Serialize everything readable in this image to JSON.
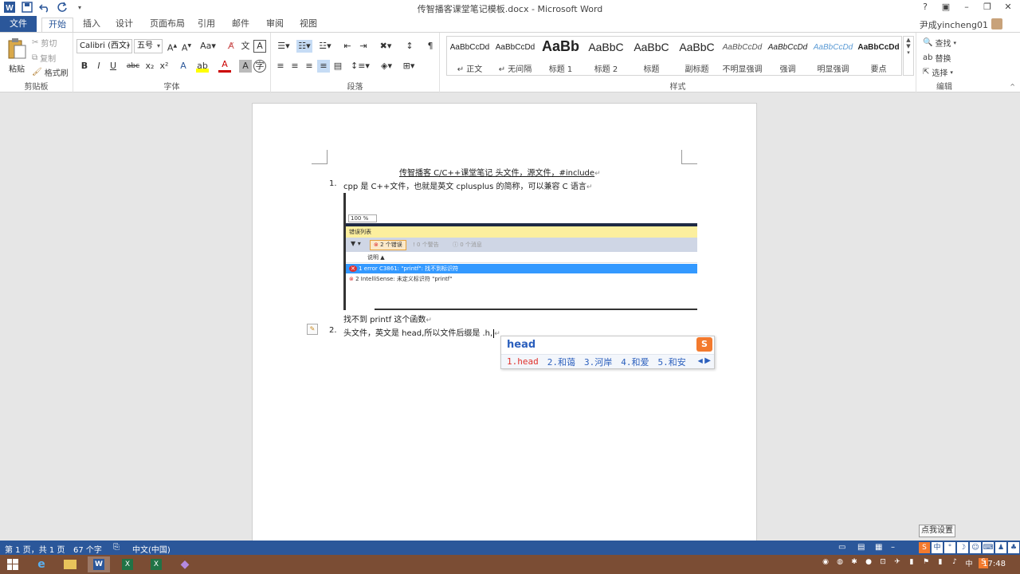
{
  "window": {
    "title": "传智播客课堂笔记模板.docx - Microsoft Word",
    "user": "尹成yincheng01",
    "controls": [
      "?",
      "▣",
      "–",
      "❐",
      "✕"
    ]
  },
  "tabs": {
    "file": "文件",
    "items": [
      "开始",
      "插入",
      "设计",
      "页面布局",
      "引用",
      "邮件",
      "审阅",
      "视图"
    ],
    "active": "开始"
  },
  "ribbon": {
    "clipboard": {
      "label": "剪贴板",
      "paste": "粘贴",
      "cut": "剪切",
      "copy": "复制",
      "format_painter": "格式刷"
    },
    "font": {
      "label": "字体",
      "font_name": "Calibri (西文)",
      "font_size": "五号"
    },
    "paragraph": {
      "label": "段落"
    },
    "styles": {
      "label": "样式",
      "items": [
        {
          "sample": "AaBbCcDd",
          "name": "↵ 正文"
        },
        {
          "sample": "AaBbCcDd",
          "name": "↵ 无间隔"
        },
        {
          "sample": "AaBb",
          "name": "标题 1"
        },
        {
          "sample": "AaBbC",
          "name": "标题 2"
        },
        {
          "sample": "AaBbC",
          "name": "标题"
        },
        {
          "sample": "AaBbC",
          "name": "副标题"
        },
        {
          "sample": "AaBbCcDd",
          "name": "不明显强调"
        },
        {
          "sample": "AaBbCcDd",
          "name": "强调"
        },
        {
          "sample": "AaBbCcDd",
          "name": "明显强调"
        },
        {
          "sample": "AaBbCcDd",
          "name": "要点"
        }
      ]
    },
    "editing": {
      "label": "编辑",
      "find": "查找",
      "replace": "替换",
      "select": "选择"
    }
  },
  "document": {
    "header_line": "传智播客 C/C++课堂笔记  头文件，源文件，#include",
    "item1_num": "1.",
    "item1": "cpp 是 C++文件，也就是英文 cplusplus 的简称，可以兼容 C 语言",
    "embedded": {
      "zoom": "100 %",
      "panel_title": "错误列表",
      "errors_btn": "2 个错误",
      "warnings_btn": "0 个警告",
      "messages_btn": "0 个消息",
      "col_desc": "说明",
      "row1": "1   error C3861: \"printf\": 找不到标识符",
      "row2": "2   IntelliSense: 未定义标识符 \"printf\""
    },
    "after_image": "找不到 printf 这个函数",
    "item2_num": "2.",
    "item2": "头文件，英文是 head,所以文件后缀是 .h,"
  },
  "ime": {
    "composition": "head",
    "candidates": [
      "1.head",
      "2.和蔼",
      "3.河岸",
      "4.和爱",
      "5.和安"
    ]
  },
  "statusbar": {
    "page": "第 1 页，共 1 页",
    "words": "67 个字",
    "language": "中文(中国)",
    "tooltip": "点我设置",
    "zoom": "+"
  },
  "taskbar": {
    "clock": "17:48"
  }
}
